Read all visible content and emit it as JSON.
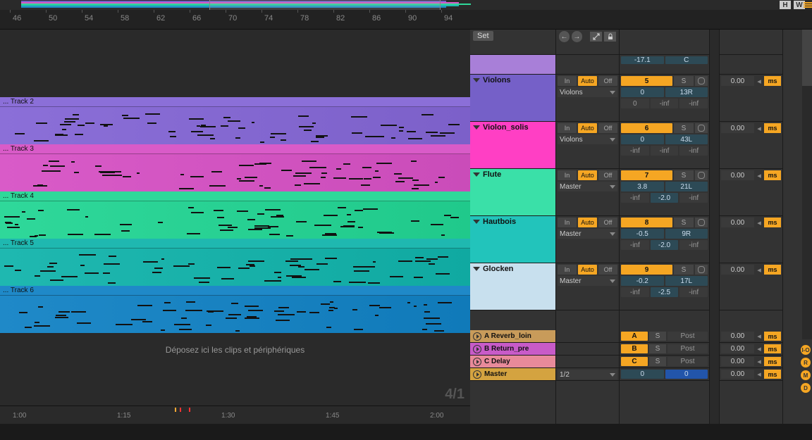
{
  "overview": {
    "h_label": "H",
    "w_label": "W"
  },
  "ruler_top": [
    "46",
    "50",
    "54",
    "58",
    "62",
    "66",
    "70",
    "74",
    "78",
    "82",
    "86",
    "90",
    "94"
  ],
  "ruler_bottom": [
    "1:00",
    "1:15",
    "1:30",
    "1:45",
    "2:00"
  ],
  "set_label": "Set",
  "dropzone_text": "Déposez ici les clips et périphériques",
  "time_signature": "4/1",
  "master_top": {
    "vol": "-17.1",
    "pan": "C"
  },
  "tracks": [
    {
      "clip_label": "... Track 2",
      "name": "Violons",
      "color": "#8b6fd8",
      "body_color": "#7560c8",
      "route": "Violons",
      "num": "5",
      "vol": "0",
      "pan": "13R",
      "sa": "0",
      "sb": "-inf",
      "sc": "-inf",
      "dly": "0.00"
    },
    {
      "clip_label": "... Track 3",
      "name": "Violon_solis",
      "color": "#d95bc8",
      "body_color": "#ff3fc4",
      "route": "Violons",
      "num": "6",
      "vol": "0",
      "pan": "43L",
      "sa": "-inf",
      "sb": "-inf",
      "sc": "-inf",
      "dly": "0.00"
    },
    {
      "clip_label": "... Track 4",
      "name": "Flute",
      "color": "#2fd89a",
      "body_color": "#3ae0a8",
      "route": "Master",
      "num": "7",
      "vol": "3.8",
      "pan": "21L",
      "sa": "-inf",
      "sb": "-2.0",
      "sc": "-inf",
      "dly": "0.00"
    },
    {
      "clip_label": "... Track 5",
      "name": "Hautbois",
      "color": "#1fb8b0",
      "body_color": "#22c4bb",
      "route": "Master",
      "num": "8",
      "vol": "-0.5",
      "pan": "9R",
      "sa": "-inf",
      "sb": "-2.0",
      "sc": "-inf",
      "dly": "0.00"
    },
    {
      "clip_label": "... Track 6",
      "name": "Glocken",
      "color": "#1f89c8",
      "body_color": "#c8e0ee",
      "route": "Master",
      "num": "9",
      "vol": "-0.2",
      "pan": "17L",
      "sa": "-inf",
      "sb": "-2.5",
      "sc": "-inf",
      "dly": "0.00"
    }
  ],
  "returns": [
    {
      "label": "A Reverb_loin",
      "color": "#c89b5a",
      "letter": "A",
      "dly": "0.00"
    },
    {
      "label": "B Return_pre",
      "color": "#c85bc8",
      "letter": "B",
      "dly": "0.00"
    },
    {
      "label": "C Delay",
      "color": "#e88a9a",
      "letter": "C",
      "dly": "0.00"
    }
  ],
  "master": {
    "label": "Master",
    "color": "#d4a340",
    "route": "1/2",
    "vol": "0",
    "pan": "0",
    "dly": "0.00"
  },
  "labels": {
    "in": "In",
    "auto": "Auto",
    "off": "Off",
    "s": "S",
    "post": "Post",
    "ms": "ms"
  },
  "edge": [
    "I-O",
    "R",
    "M",
    "D"
  ]
}
